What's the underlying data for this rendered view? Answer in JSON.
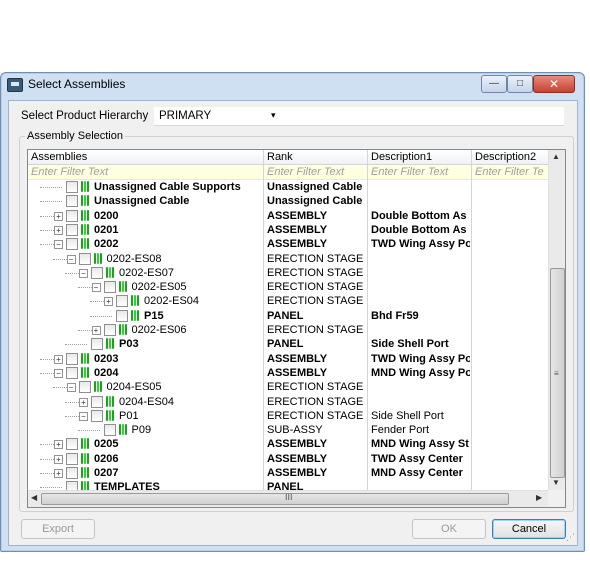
{
  "window": {
    "title": "Select Assemblies",
    "min_glyph": "—",
    "max_glyph": "□",
    "close_glyph": "✕"
  },
  "hierarchy": {
    "label": "Select Product Hierarchy",
    "value": "PRIMARY",
    "arrow": "▾"
  },
  "group": {
    "title": "Assembly Selection"
  },
  "grid": {
    "columns": [
      "Assemblies",
      "Rank",
      "Description1",
      "Description2"
    ],
    "filter_placeholder": "Enter Filter Text",
    "filter_placeholder_short": "Enter Filter Te",
    "rows": [
      {
        "name": "Unassigned Cable Supports",
        "rank": "Unassigned Cable",
        "desc1": "",
        "bold": true,
        "level": 1,
        "expander": "none"
      },
      {
        "name": "Unassigned Cable",
        "rank": "Unassigned Cable",
        "desc1": "",
        "bold": true,
        "level": 1,
        "expander": "none"
      },
      {
        "name": "0200",
        "rank": "ASSEMBLY",
        "desc1": "Double Bottom As",
        "bold": true,
        "level": 1,
        "expander": "+"
      },
      {
        "name": "0201",
        "rank": "ASSEMBLY",
        "desc1": "Double Bottom As",
        "bold": true,
        "level": 1,
        "expander": "+"
      },
      {
        "name": "0202",
        "rank": "ASSEMBLY",
        "desc1": "TWD Wing Assy Po",
        "bold": true,
        "level": 1,
        "expander": "-"
      },
      {
        "name": "0202-ES08",
        "rank": "ERECTION STAGE",
        "desc1": "",
        "bold": false,
        "level": 2,
        "expander": "-"
      },
      {
        "name": "0202-ES07",
        "rank": "ERECTION STAGE",
        "desc1": "",
        "bold": false,
        "level": 3,
        "expander": "-"
      },
      {
        "name": "0202-ES05",
        "rank": "ERECTION STAGE",
        "desc1": "",
        "bold": false,
        "level": 4,
        "expander": "-"
      },
      {
        "name": "0202-ES04",
        "rank": "ERECTION STAGE",
        "desc1": "",
        "bold": false,
        "level": 5,
        "expander": "+"
      },
      {
        "name": "P15",
        "rank": "PANEL",
        "desc1": "Bhd Fr59",
        "bold": true,
        "level": 5,
        "expander": "none"
      },
      {
        "name": "0202-ES06",
        "rank": "ERECTION STAGE",
        "desc1": "",
        "bold": false,
        "level": 4,
        "expander": "+"
      },
      {
        "name": "P03",
        "rank": "PANEL",
        "desc1": "Side Shell Port",
        "bold": true,
        "level": 3,
        "expander": "none"
      },
      {
        "name": "0203",
        "rank": "ASSEMBLY",
        "desc1": "TWD Wing Assy Po",
        "bold": true,
        "level": 1,
        "expander": "+"
      },
      {
        "name": "0204",
        "rank": "ASSEMBLY",
        "desc1": "MND Wing Assy Po",
        "bold": true,
        "level": 1,
        "expander": "-"
      },
      {
        "name": "0204-ES05",
        "rank": "ERECTION STAGE",
        "desc1": "",
        "bold": false,
        "level": 2,
        "expander": "-"
      },
      {
        "name": "0204-ES04",
        "rank": "ERECTION STAGE",
        "desc1": "",
        "bold": false,
        "level": 3,
        "expander": "+"
      },
      {
        "name": "P01",
        "rank": "ERECTION STAGE",
        "desc1": "Side Shell Port",
        "bold": false,
        "level": 3,
        "expander": "-"
      },
      {
        "name": "P09",
        "rank": "SUB-ASSY",
        "desc1": "Fender Port",
        "bold": false,
        "level": 4,
        "expander": "none"
      },
      {
        "name": "0205",
        "rank": "ASSEMBLY",
        "desc1": "MND Wing Assy St",
        "bold": true,
        "level": 1,
        "expander": "+"
      },
      {
        "name": "0206",
        "rank": "ASSEMBLY",
        "desc1": "TWD Assy Center",
        "bold": true,
        "level": 1,
        "expander": "+"
      },
      {
        "name": "0207",
        "rank": "ASSEMBLY",
        "desc1": "MND Assy Center",
        "bold": true,
        "level": 1,
        "expander": "+"
      },
      {
        "name": "TEMPLATES",
        "rank": "PANEL",
        "desc1": "",
        "bold": true,
        "level": 1,
        "expander": "none"
      }
    ],
    "scroll": {
      "up": "▲",
      "down": "▼",
      "left": "◀",
      "right": "▶",
      "grip": "≡",
      "hgrip": "III"
    }
  },
  "buttons": {
    "export": "Export",
    "ok": "OK",
    "cancel": "Cancel"
  },
  "colors": {
    "node_icon": "#1aa31a",
    "filter_bg": "#ffffe1"
  }
}
